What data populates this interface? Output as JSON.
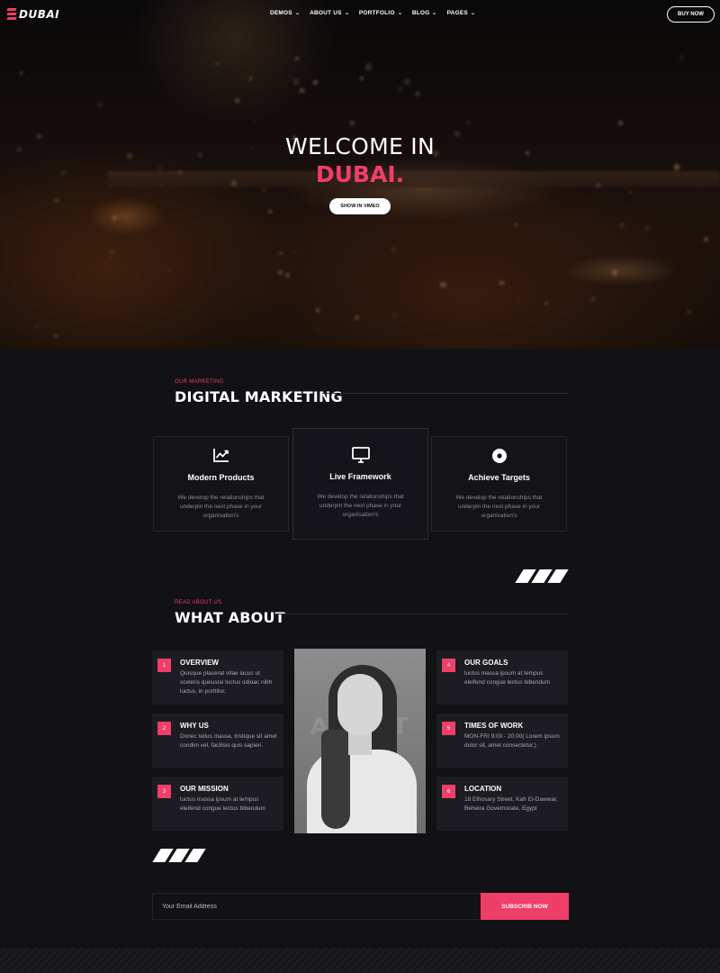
{
  "brand": {
    "logo_text": "DUBAI",
    "accent": "#ef3e67"
  },
  "nav": {
    "items": [
      {
        "label": "DEMOS"
      },
      {
        "label": "ABOUT US"
      },
      {
        "label": "PORTFOLIO"
      },
      {
        "label": "BLOG"
      },
      {
        "label": "PAGES"
      }
    ],
    "cta": "BUY NOW"
  },
  "hero": {
    "title": "WELCOME IN",
    "accent": "DUBAI.",
    "button": "SHOW IN VIMEO"
  },
  "marketing": {
    "eyebrow": "OUR MARKETING",
    "title": "DIGITAL MARKETING",
    "services": [
      {
        "icon": "chart-line-icon",
        "title": "Modern Products",
        "desc": "We develop the relationships that underpin the next phase in your organisation's"
      },
      {
        "icon": "monitor-icon",
        "title": "Live Framework",
        "desc": "We develop the relationships that underpin the next phase in your organisation's"
      },
      {
        "icon": "target-icon",
        "title": "Achieve Targets",
        "desc": "We develop the relationships that underpin the next phase in your organisation's"
      }
    ]
  },
  "about": {
    "eyebrow": "READ ABOUT US",
    "title": "WHAT ABOUT",
    "watermark": "ABOUT",
    "cards": [
      {
        "num": "1",
        "title": "OVERVIEW",
        "desc": "Quisque placerat vitae lacus ut sceleris queusce luctus odioac nibh luctus, in porttitor."
      },
      {
        "num": "2",
        "title": "WHY US",
        "desc": "Donec tellus massa, tristique sit amet condim vel, facilisis quis sapien."
      },
      {
        "num": "3",
        "title": "OUR MISSION",
        "desc": "luctus massa ipsum at tempus eleifend congue lectus bibendum"
      },
      {
        "num": "4",
        "title": "OUR GOALS",
        "desc": "luctus massa ipsum at tempus eleifend congue lectus bibendum"
      },
      {
        "num": "5",
        "title": "TIMES OF WORK",
        "desc": "MON-FRI 9:00 - 20:00( Lorem ipsum dolor sit, amet consectetur.)"
      },
      {
        "num": "6",
        "title": "LOCATION",
        "desc": "18 Elhosary Street, Kafr El-Dawwar, Beheira Governorate, Egypt"
      }
    ]
  },
  "subscribe": {
    "placeholder": "Your Email Address",
    "button": "SUBSCRIB NOW"
  }
}
